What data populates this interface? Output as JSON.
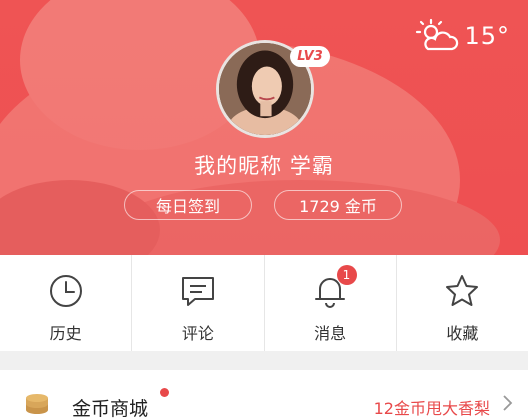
{
  "header": {
    "weather": {
      "icon": "partly-cloudy-icon",
      "temperature": "15°"
    },
    "level_badge": "LV3",
    "nickname": "我的昵称 学霸",
    "checkin_label": "每日签到",
    "coins_label": "1729 金币",
    "accent_color": "#ee4f51"
  },
  "shortcuts": [
    {
      "icon": "clock-icon",
      "label": "历史"
    },
    {
      "icon": "comment-icon",
      "label": "评论"
    },
    {
      "icon": "bell-icon",
      "label": "消息",
      "badge": "1"
    },
    {
      "icon": "star-icon",
      "label": "收藏"
    }
  ],
  "list": {
    "coin_mall": {
      "icon": "coin-stack-icon",
      "title": "金币商城",
      "promo": "12金币甩大香梨"
    }
  }
}
